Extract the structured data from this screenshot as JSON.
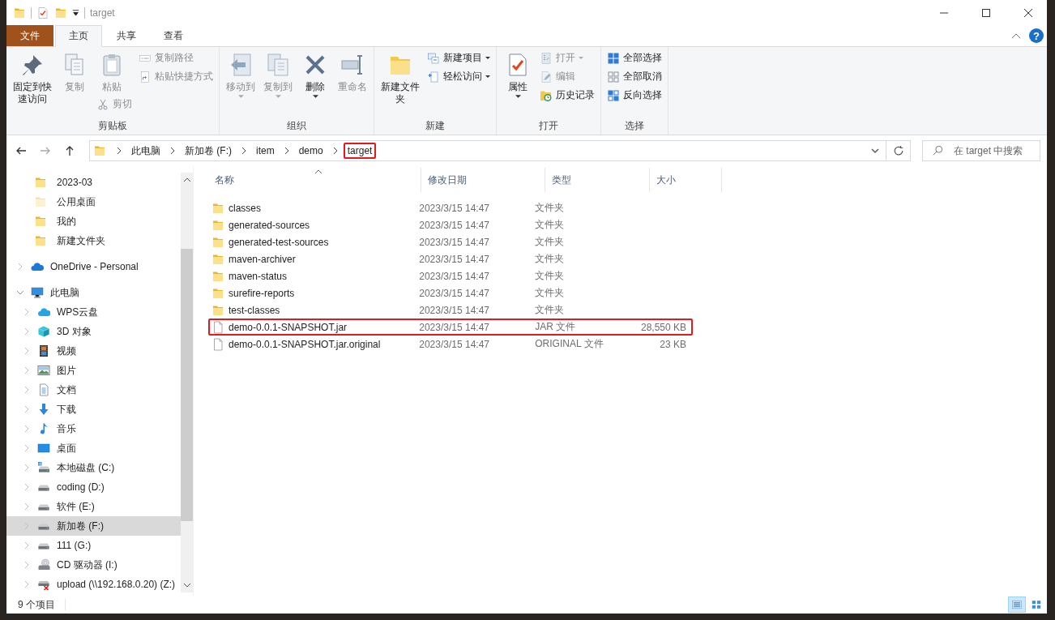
{
  "window": {
    "title": "target"
  },
  "ribbon_tabs": [
    {
      "label": "文件",
      "kind": "file",
      "selected": false
    },
    {
      "label": "主页",
      "kind": "tab",
      "selected": true
    },
    {
      "label": "共享",
      "kind": "tab",
      "selected": false
    },
    {
      "label": "查看",
      "kind": "tab",
      "selected": false
    }
  ],
  "help_button": "?",
  "ribbon_groups": [
    {
      "label": "剪贴板",
      "columns": [
        {
          "buttons": [
            {
              "label": "固定到快速访问",
              "kind": "pin",
              "large": true,
              "disabled": false,
              "dropdown": false
            }
          ]
        },
        {
          "buttons": [
            {
              "label": "复制",
              "kind": "copy",
              "large": true,
              "disabled": true,
              "dropdown": false
            }
          ]
        },
        {
          "buttons": [
            {
              "label": "粘贴",
              "kind": "paste",
              "large": true,
              "disabled": true,
              "dropdown": false
            },
            {
              "label": "剪切",
              "kind": "cut",
              "large": false,
              "disabled": true,
              "dropdown": false
            }
          ]
        },
        {
          "buttons": [
            {
              "label": "复制路径",
              "kind": "copypath",
              "large": false,
              "disabled": true,
              "dropdown": false
            },
            {
              "label": "粘贴快捷方式",
              "kind": "shortcut",
              "large": false,
              "disabled": true,
              "dropdown": false
            }
          ]
        }
      ]
    },
    {
      "label": "组织",
      "columns": [
        {
          "buttons": [
            {
              "label": "移动到",
              "kind": "moveto",
              "large": true,
              "disabled": true,
              "dropdown": true
            }
          ]
        },
        {
          "buttons": [
            {
              "label": "复制到",
              "kind": "copyto",
              "large": true,
              "disabled": true,
              "dropdown": true
            }
          ]
        },
        {
          "buttons": [
            {
              "label": "删除",
              "kind": "delete",
              "large": true,
              "disabled": false,
              "dropdown": true
            }
          ]
        },
        {
          "buttons": [
            {
              "label": "重命名",
              "kind": "rename",
              "large": true,
              "disabled": true,
              "dropdown": false
            }
          ]
        }
      ]
    },
    {
      "label": "新建",
      "columns": [
        {
          "buttons": [
            {
              "label": "新建文件夹",
              "kind": "newfolder",
              "large": true,
              "disabled": false,
              "dropdown": false
            }
          ]
        },
        {
          "buttons": [
            {
              "label": "新建项目",
              "kind": "newitem",
              "large": false,
              "disabled": false,
              "dropdown": true
            },
            {
              "label": "轻松访问",
              "kind": "easyaccess",
              "large": false,
              "disabled": false,
              "dropdown": true
            }
          ]
        }
      ]
    },
    {
      "label": "打开",
      "columns": [
        {
          "buttons": [
            {
              "label": "属性",
              "kind": "properties",
              "large": true,
              "disabled": false,
              "dropdown": true
            }
          ]
        },
        {
          "buttons": [
            {
              "label": "打开",
              "kind": "open",
              "large": false,
              "disabled": true,
              "dropdown": true
            },
            {
              "label": "编辑",
              "kind": "edit",
              "large": false,
              "disabled": true,
              "dropdown": false
            },
            {
              "label": "历史记录",
              "kind": "history",
              "large": false,
              "disabled": false,
              "dropdown": false
            }
          ]
        }
      ]
    },
    {
      "label": "选择",
      "columns": [
        {
          "buttons": [
            {
              "label": "全部选择",
              "kind": "selectall",
              "large": false,
              "disabled": false,
              "dropdown": false
            },
            {
              "label": "全部取消",
              "kind": "selectnone",
              "large": false,
              "disabled": false,
              "dropdown": false
            },
            {
              "label": "反向选择",
              "kind": "invert",
              "large": false,
              "disabled": false,
              "dropdown": false
            }
          ]
        }
      ]
    }
  ],
  "address": {
    "breadcrumbs": [
      {
        "label": "此电脑",
        "highlighted": false
      },
      {
        "label": "新加卷 (F:)",
        "highlighted": false
      },
      {
        "label": "item",
        "highlighted": false
      },
      {
        "label": "demo",
        "highlighted": false
      },
      {
        "label": "target",
        "highlighted": true
      }
    ]
  },
  "search": {
    "placeholder": "在 target 中搜索"
  },
  "nav": {
    "quick_access_items": [
      {
        "label": "2023-03",
        "kind": "folder",
        "selected": false
      },
      {
        "label": "公用桌面",
        "kind": "folder-faded",
        "selected": false
      },
      {
        "label": "我的",
        "kind": "folder",
        "selected": false
      },
      {
        "label": "新建文件夹",
        "kind": "folder",
        "selected": false
      }
    ],
    "items": [
      {
        "label": "OneDrive - Personal",
        "kind": "onedrive",
        "expanded": false,
        "selected": false
      },
      {
        "label": "此电脑",
        "kind": "pc",
        "expanded": true,
        "selected": false,
        "children": [
          {
            "label": "WPS云盘",
            "kind": "wps",
            "expanded": false,
            "selected": false
          },
          {
            "label": "3D 对象",
            "kind": "cube",
            "expanded": false,
            "selected": false
          },
          {
            "label": "视频",
            "kind": "video",
            "expanded": false,
            "selected": false
          },
          {
            "label": "图片",
            "kind": "pictures",
            "expanded": false,
            "selected": false
          },
          {
            "label": "文档",
            "kind": "documents",
            "expanded": false,
            "selected": false
          },
          {
            "label": "下载",
            "kind": "download",
            "expanded": false,
            "selected": false
          },
          {
            "label": "音乐",
            "kind": "music",
            "expanded": false,
            "selected": false
          },
          {
            "label": "桌面",
            "kind": "desktop",
            "expanded": false,
            "selected": false
          },
          {
            "label": "本地磁盘 (C:)",
            "kind": "sysdrive",
            "expanded": false,
            "selected": false
          },
          {
            "label": "coding (D:)",
            "kind": "drive",
            "expanded": false,
            "selected": false
          },
          {
            "label": "软件 (E:)",
            "kind": "drive",
            "expanded": false,
            "selected": false
          },
          {
            "label": "新加卷 (F:)",
            "kind": "drive",
            "expanded": false,
            "selected": true
          },
          {
            "label": "111 (G:)",
            "kind": "drive",
            "expanded": false,
            "selected": false
          },
          {
            "label": "CD 驱动器 (I:)",
            "kind": "cd",
            "expanded": false,
            "selected": false
          },
          {
            "label": "upload (\\\\192.168.0.20) (Z:)",
            "kind": "netdrive",
            "expanded": false,
            "selected": false
          }
        ]
      }
    ]
  },
  "table": {
    "columns": [
      {
        "label": "名称",
        "sorted": true
      },
      {
        "label": "修改日期",
        "sorted": false
      },
      {
        "label": "类型",
        "sorted": false
      },
      {
        "label": "大小",
        "sorted": false
      }
    ],
    "rows": [
      {
        "name": "classes",
        "date": "2023/3/15 14:47",
        "type": "文件夹",
        "kind": "folder",
        "highlighted": false
      },
      {
        "name": "generated-sources",
        "date": "2023/3/15 14:47",
        "type": "文件夹",
        "kind": "folder",
        "highlighted": false
      },
      {
        "name": "generated-test-sources",
        "date": "2023/3/15 14:47",
        "type": "文件夹",
        "kind": "folder",
        "highlighted": false
      },
      {
        "name": "maven-archiver",
        "date": "2023/3/15 14:47",
        "type": "文件夹",
        "kind": "folder",
        "highlighted": false
      },
      {
        "name": "maven-status",
        "date": "2023/3/15 14:47",
        "type": "文件夹",
        "kind": "folder",
        "highlighted": false
      },
      {
        "name": "surefire-reports",
        "date": "2023/3/15 14:47",
        "type": "文件夹",
        "kind": "folder",
        "highlighted": false
      },
      {
        "name": "test-classes",
        "date": "2023/3/15 14:47",
        "type": "文件夹",
        "kind": "folder",
        "highlighted": false
      },
      {
        "name": "demo-0.0.1-SNAPSHOT.jar",
        "date": "2023/3/15 14:47",
        "type": "JAR 文件",
        "size": "28,550 KB",
        "kind": "file",
        "highlighted": true
      },
      {
        "name": "demo-0.0.1-SNAPSHOT.jar.original",
        "date": "2023/3/15 14:47",
        "type": "ORIGINAL 文件",
        "size": "23 KB",
        "kind": "file",
        "highlighted": false
      }
    ]
  },
  "status_bar": {
    "item_count": "9 个项目",
    "views": [
      {
        "kind": "details",
        "selected": true
      },
      {
        "kind": "large-icons",
        "selected": false
      }
    ]
  }
}
